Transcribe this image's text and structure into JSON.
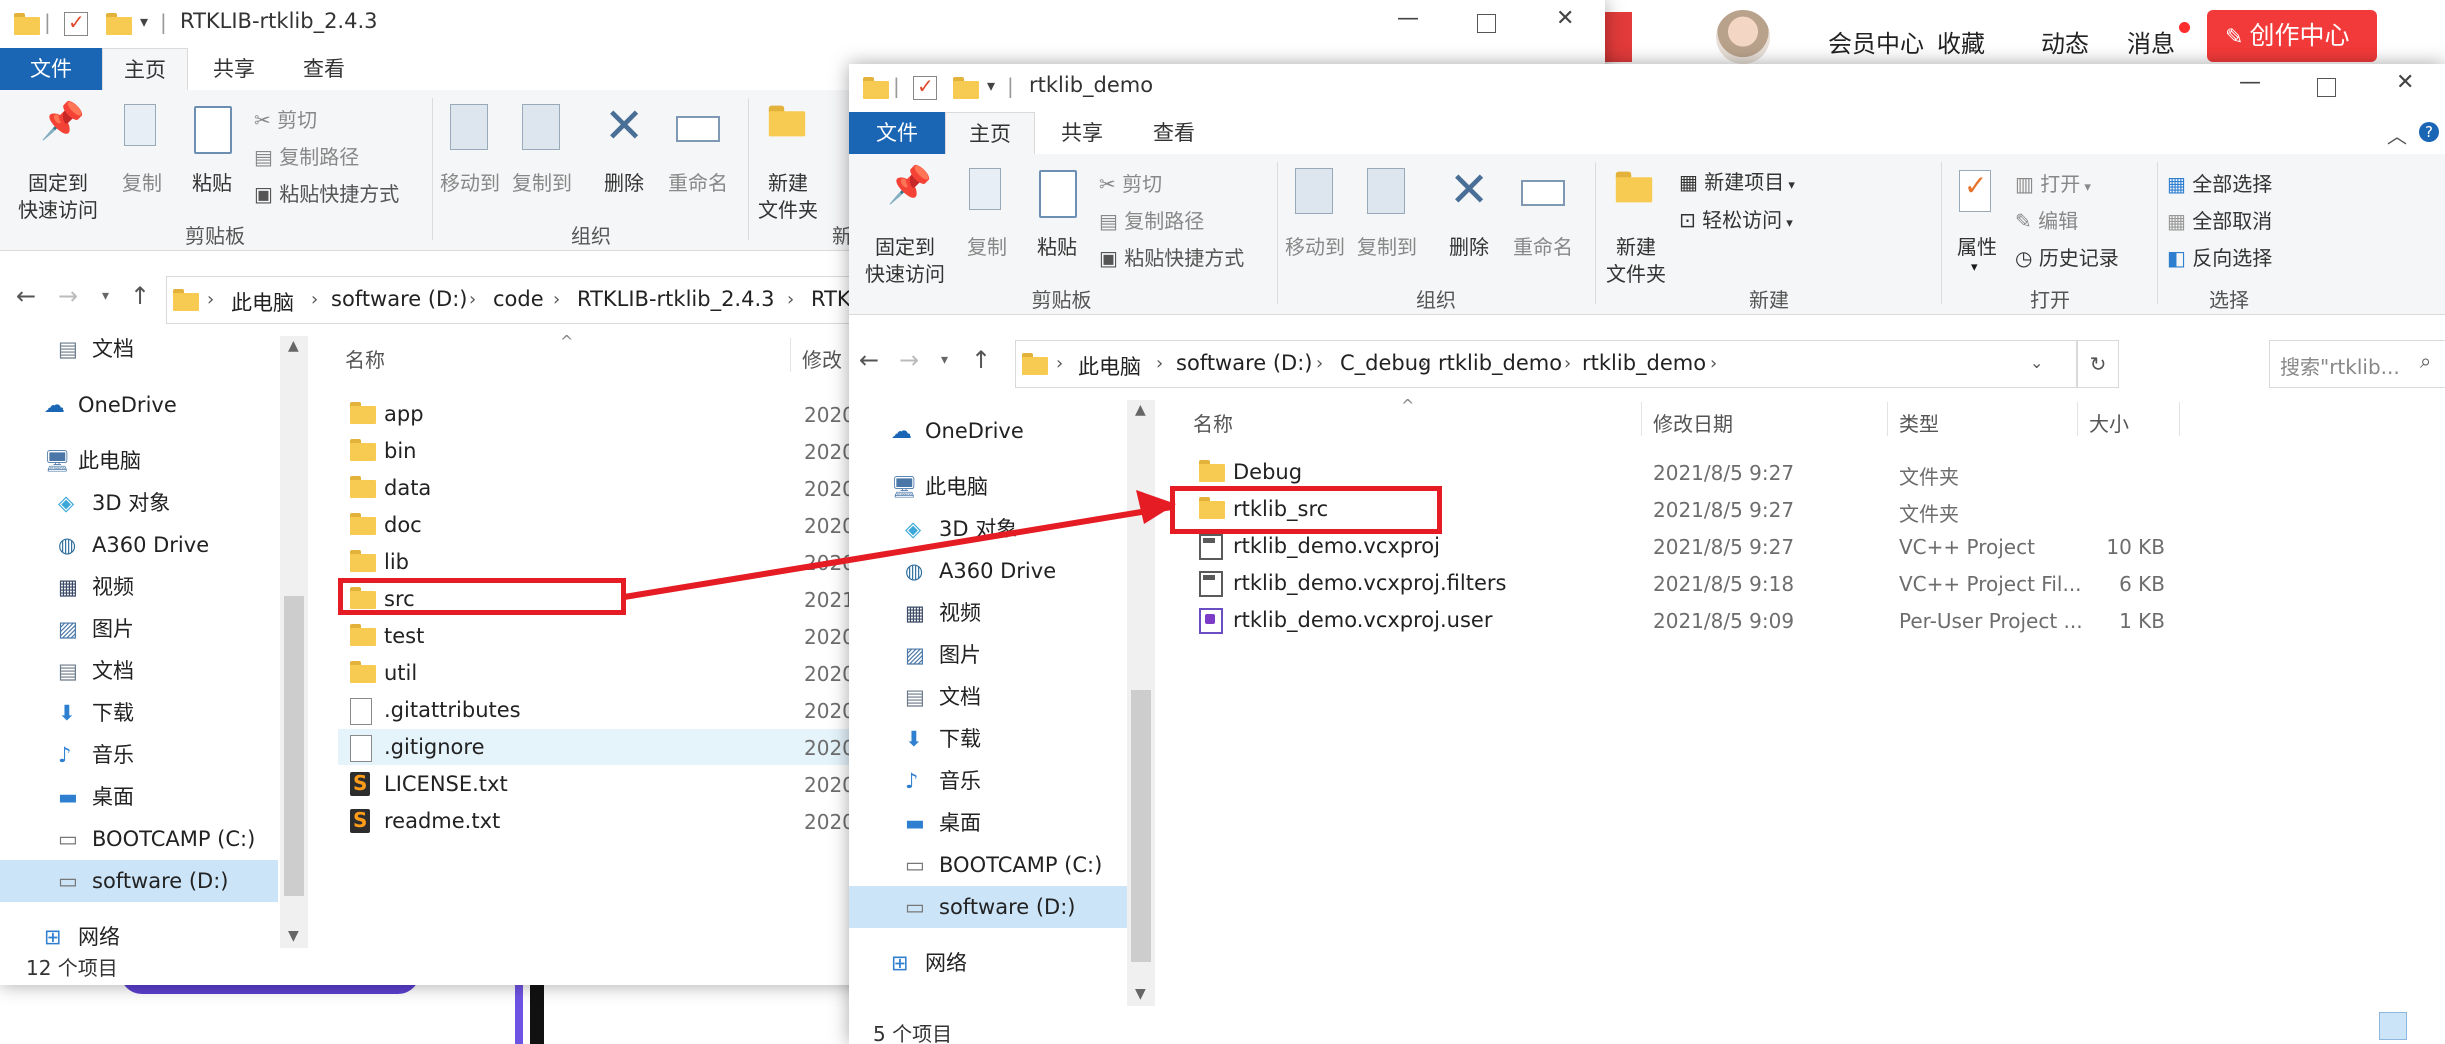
{
  "background_page": {
    "links": [
      "会员中心",
      "收藏",
      "动态",
      "消息"
    ],
    "create_button": "创作中心",
    "accent_color": "#f33a3a"
  },
  "left_window": {
    "title": "RTKLIB-rtklib_2.4.3",
    "tabs": [
      "文件",
      "主页",
      "共享",
      "查看"
    ],
    "ribbon": {
      "pin_label_1": "固定到",
      "pin_label_2": "快速访问",
      "copy": "复制",
      "paste": "粘贴",
      "cut": "剪切",
      "copy_path": "复制路径",
      "paste_shortcut": "粘贴快捷方式",
      "clipboard_group": "剪贴板",
      "move_to": "移动到",
      "copy_to": "复制到",
      "delete": "删除",
      "rename": "重命名",
      "organize_group": "组织",
      "new_folder_1": "新建",
      "new_folder_2": "文件夹",
      "new_group_partial": "新"
    },
    "breadcrumb": [
      "此电脑",
      "software (D:)",
      "code",
      "RTKLIB-rtklib_2.4.3",
      "RTKL"
    ],
    "nav": [
      {
        "label": "文档",
        "icon": "document-icon"
      },
      {
        "label": "OneDrive",
        "icon": "onedrive-icon"
      },
      {
        "label": "此电脑",
        "icon": "computer-icon"
      },
      {
        "label": "3D 对象",
        "icon": "3d-objects-icon"
      },
      {
        "label": "A360 Drive",
        "icon": "a360-drive-icon"
      },
      {
        "label": "视频",
        "icon": "video-icon"
      },
      {
        "label": "图片",
        "icon": "pictures-icon"
      },
      {
        "label": "文档",
        "icon": "document-icon"
      },
      {
        "label": "下载",
        "icon": "download-icon"
      },
      {
        "label": "音乐",
        "icon": "music-icon"
      },
      {
        "label": "桌面",
        "icon": "desktop-icon"
      },
      {
        "label": "BOOTCAMP (C:)",
        "icon": "drive-icon"
      },
      {
        "label": "software (D:)",
        "icon": "drive-icon"
      },
      {
        "label": "网络",
        "icon": "network-icon"
      }
    ],
    "columns": {
      "name": "名称",
      "date_partial": "修改"
    },
    "files": [
      {
        "name": "app",
        "date": "2020",
        "kind": "folder"
      },
      {
        "name": "bin",
        "date": "2020",
        "kind": "folder"
      },
      {
        "name": "data",
        "date": "2020",
        "kind": "folder"
      },
      {
        "name": "doc",
        "date": "2020",
        "kind": "folder"
      },
      {
        "name": "lib",
        "date": "2020",
        "kind": "folder"
      },
      {
        "name": "src",
        "date": "2021",
        "kind": "folder"
      },
      {
        "name": "test",
        "date": "2020",
        "kind": "folder"
      },
      {
        "name": "util",
        "date": "2020",
        "kind": "folder"
      },
      {
        "name": ".gitattributes",
        "date": "2020",
        "kind": "file"
      },
      {
        "name": ".gitignore",
        "date": "2020",
        "kind": "file"
      },
      {
        "name": "LICENSE.txt",
        "date": "2020",
        "kind": "text"
      },
      {
        "name": "readme.txt",
        "date": "2020",
        "kind": "text"
      }
    ],
    "status": "12 个项目"
  },
  "right_window": {
    "title": "rtklib_demo",
    "tabs": [
      "文件",
      "主页",
      "共享",
      "查看"
    ],
    "ribbon": {
      "pin_label_1": "固定到",
      "pin_label_2": "快速访问",
      "copy": "复制",
      "paste": "粘贴",
      "cut": "剪切",
      "copy_path": "复制路径",
      "paste_shortcut": "粘贴快捷方式",
      "clipboard_group": "剪贴板",
      "move_to": "移动到",
      "copy_to": "复制到",
      "delete": "删除",
      "rename": "重命名",
      "organize_group": "组织",
      "new_folder_1": "新建",
      "new_folder_2": "文件夹",
      "new_item": "新建项目",
      "easy_access": "轻松访问",
      "new_group": "新建",
      "properties": "属性",
      "open": "打开",
      "edit": "编辑",
      "history": "历史记录",
      "open_group": "打开",
      "select_all": "全部选择",
      "select_none": "全部取消",
      "invert_selection": "反向选择",
      "select_group": "选择"
    },
    "breadcrumb": [
      "此电脑",
      "software (D:)",
      "C_debug",
      "rtklib_demo",
      "rtklib_demo"
    ],
    "search_placeholder": "搜索\"rtklib...",
    "nav": [
      {
        "label": "OneDrive",
        "icon": "onedrive-icon"
      },
      {
        "label": "此电脑",
        "icon": "computer-icon"
      },
      {
        "label": "3D 对象",
        "icon": "3d-objects-icon"
      },
      {
        "label": "A360 Drive",
        "icon": "a360-drive-icon"
      },
      {
        "label": "视频",
        "icon": "video-icon"
      },
      {
        "label": "图片",
        "icon": "pictures-icon"
      },
      {
        "label": "文档",
        "icon": "document-icon"
      },
      {
        "label": "下载",
        "icon": "download-icon"
      },
      {
        "label": "音乐",
        "icon": "music-icon"
      },
      {
        "label": "桌面",
        "icon": "desktop-icon"
      },
      {
        "label": "BOOTCAMP (C:)",
        "icon": "drive-icon"
      },
      {
        "label": "software (D:)",
        "icon": "drive-icon"
      },
      {
        "label": "网络",
        "icon": "network-icon"
      }
    ],
    "columns": {
      "name": "名称",
      "date": "修改日期",
      "type": "类型",
      "size": "大小"
    },
    "files": [
      {
        "name": "Debug",
        "date": "2021/8/5 9:27",
        "type": "文件夹",
        "size": "",
        "kind": "folder"
      },
      {
        "name": "rtklib_src",
        "date": "2021/8/5 9:27",
        "type": "文件夹",
        "size": "",
        "kind": "folder"
      },
      {
        "name": "rtklib_demo.vcxproj",
        "date": "2021/8/5 9:27",
        "type": "VC++ Project",
        "size": "10 KB",
        "kind": "proj"
      },
      {
        "name": "rtklib_demo.vcxproj.filters",
        "date": "2021/8/5 9:18",
        "type": "VC++ Project Fil...",
        "size": "6 KB",
        "kind": "proj"
      },
      {
        "name": "rtklib_demo.vcxproj.user",
        "date": "2021/8/5 9:09",
        "type": "Per-User Project ...",
        "size": "1 KB",
        "kind": "user"
      }
    ],
    "status": "5 个项目"
  }
}
